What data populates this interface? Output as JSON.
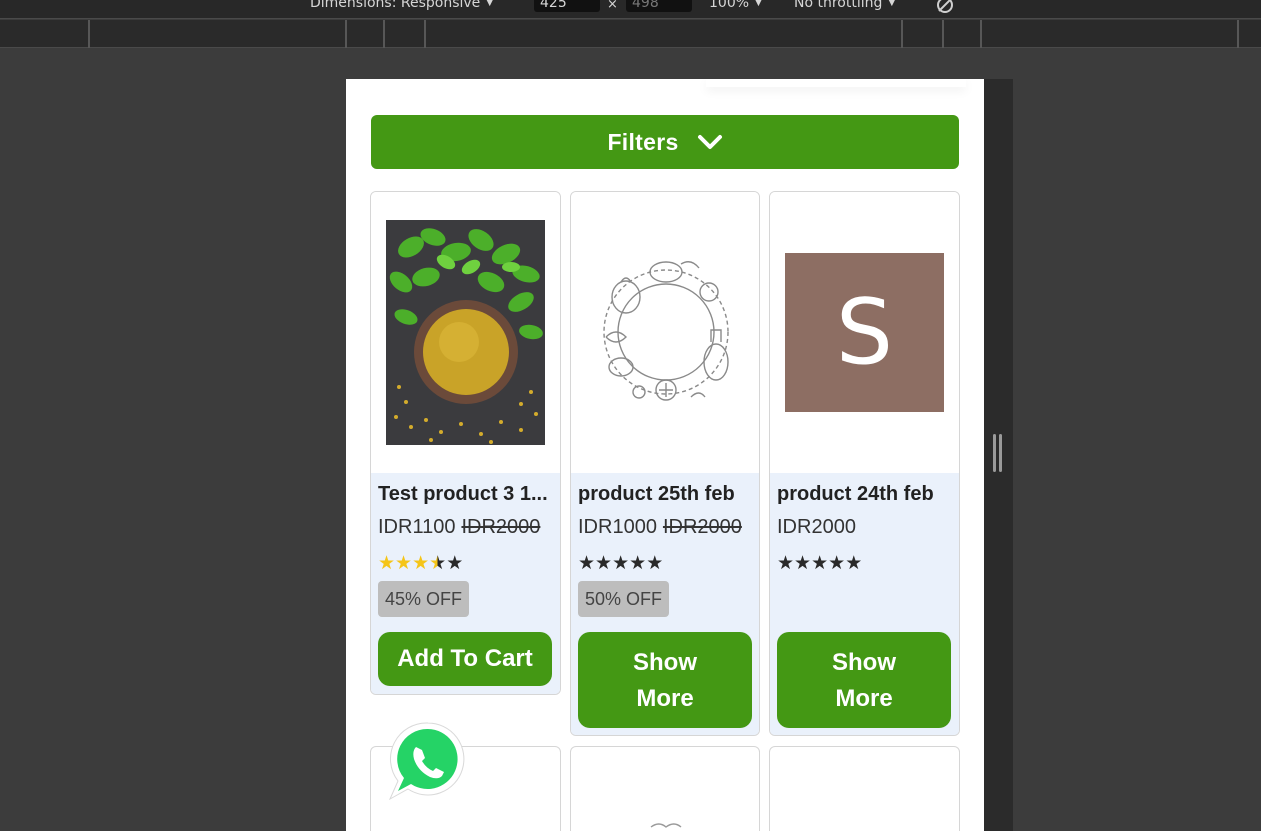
{
  "devtools": {
    "dimensions_label": "Dimensions: Responsive",
    "width_value": "425",
    "times": "×",
    "height_value": "498",
    "zoom": "100%",
    "throttle": "No throttling"
  },
  "filters": {
    "label": "Filters"
  },
  "products": [
    {
      "name": "Test product 3 1...",
      "price": "IDR1100",
      "old_price": "IDR2000",
      "rating": 3.5,
      "discount": "45% OFF",
      "button_line1": "Add To Cart",
      "button_line2": ""
    },
    {
      "name": "product 25th feb",
      "price": "IDR1000",
      "old_price": "IDR2000",
      "rating": 0,
      "discount": "50% OFF",
      "button_line1": "Show",
      "button_line2": "More"
    },
    {
      "name": "product 24th feb",
      "price": "IDR2000",
      "old_price": "",
      "rating": 0,
      "discount": "",
      "button_line1": "Show",
      "button_line2": "More",
      "placeholder_letter": "S"
    }
  ],
  "colors": {
    "brand_green": "#449814",
    "star_gold": "#f5c518",
    "whatsapp_green": "#25d366"
  }
}
